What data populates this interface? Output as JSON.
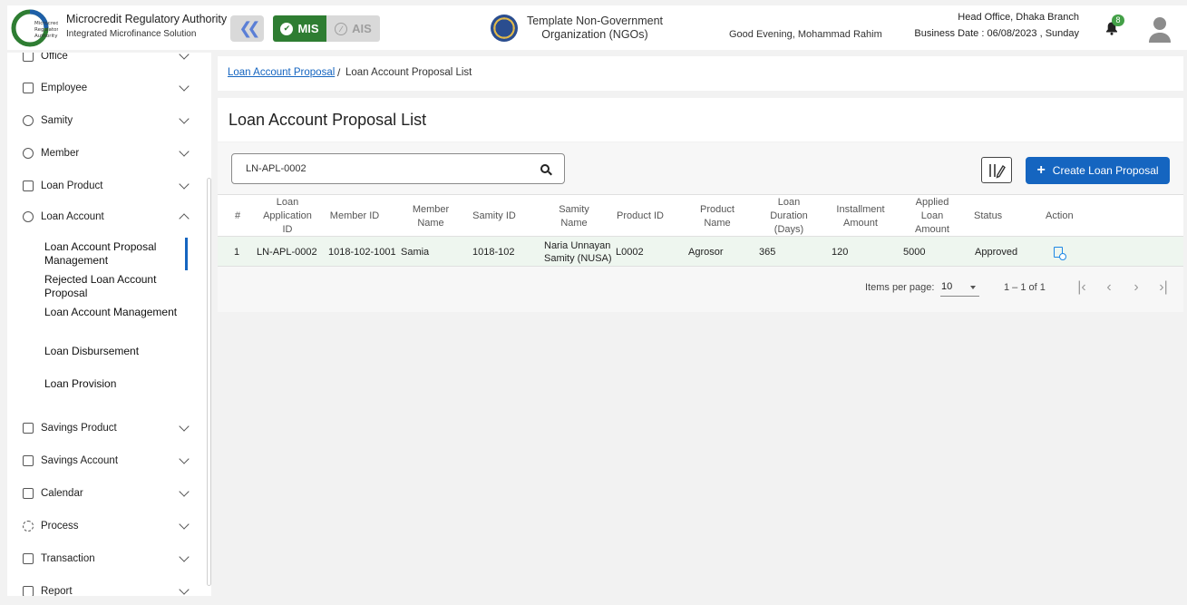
{
  "header": {
    "org_title": "Microcredit Regulatory Authority",
    "org_sub": "Integrated Microfinance Solution",
    "logo_text": "Microcredit Regulatory Authority",
    "mode_mis": "MIS",
    "mode_ais": "AIS",
    "ngo_line1": "Template Non-Government",
    "ngo_line2": "Organization (NGOs)",
    "greeting": "Good Evening, Mohammad Rahim",
    "branch": "Head Office, Dhaka Branch",
    "business_date": "Business Date : 06/08/2023 , Sunday",
    "notification_count": "8",
    "accent": "#2e7d32"
  },
  "sidebar": {
    "items": [
      {
        "label": "Office",
        "icon": "office-icon"
      },
      {
        "label": "Employee",
        "icon": "employee-icon"
      },
      {
        "label": "Samity",
        "icon": "samity-icon"
      },
      {
        "label": "Member",
        "icon": "member-icon"
      },
      {
        "label": "Loan Product",
        "icon": "loan-product-icon"
      },
      {
        "label": "Loan Account",
        "icon": "loan-account-icon"
      },
      {
        "label": "Savings Product",
        "icon": "savings-product-icon"
      },
      {
        "label": "Savings Account",
        "icon": "savings-account-icon"
      },
      {
        "label": "Calendar",
        "icon": "calendar-icon"
      },
      {
        "label": "Process",
        "icon": "process-icon"
      },
      {
        "label": "Transaction",
        "icon": "transaction-icon"
      },
      {
        "label": "Report",
        "icon": "report-icon"
      }
    ],
    "sub_items": [
      {
        "label": "Loan Account Proposal Management"
      },
      {
        "label": "Rejected Loan Account Proposal"
      },
      {
        "label": "Loan Account Management"
      },
      {
        "label": "Loan Disbursement"
      },
      {
        "label": "Loan Provision"
      }
    ]
  },
  "breadcrumb": {
    "link": "Loan Account Proposal",
    "separator": "/",
    "current": "Loan Account Proposal List"
  },
  "page": {
    "title": "Loan Account Proposal List",
    "search_value": "LN-APL-0002",
    "create_label": "Create Loan Proposal",
    "brand_color": "#1565c0"
  },
  "table": {
    "headers": [
      "#",
      "Loan Application ID",
      "Member ID",
      "Member Name",
      "Samity ID",
      "Samity Name",
      "Product ID",
      "Product Name",
      "Loan Duration (Days)",
      "Installment Amount",
      "Applied Loan Amount",
      "Status",
      "Action"
    ],
    "rows": [
      [
        "1",
        "LN-APL-0002",
        "1018-102-1001",
        "Samia",
        "1018-102",
        "Naria Unnayan Samity (NUSA)",
        "L0002",
        "Agrosor",
        "365",
        "120",
        "5000",
        "Approved"
      ]
    ]
  },
  "pagination": {
    "items_per_page_label": "Items per page:",
    "items_per_page": "10",
    "range": "1 – 1 of 1"
  }
}
